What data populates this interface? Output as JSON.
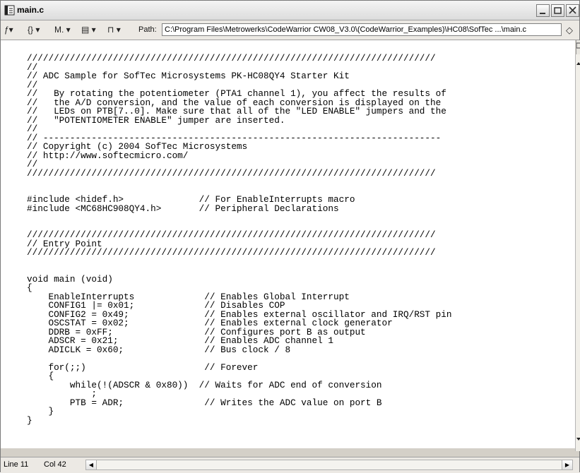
{
  "window": {
    "title": "main.c"
  },
  "toolbar": {
    "items": [
      {
        "icon": "function-icon",
        "label": "ƒ▾"
      },
      {
        "icon": "braces-icon",
        "label": "{} ▾"
      },
      {
        "icon": "marker-icon",
        "label": "M. ▾"
      },
      {
        "icon": "document-icon",
        "label": "▤ ▾"
      },
      {
        "icon": "lock-icon",
        "label": "⊓ ▾"
      }
    ],
    "path_label": "Path:",
    "path_value": "C:\\Program Files\\Metrowerks\\CodeWarrior CW08_V3.0\\(CodeWarrior_Examples)\\HC08\\SofTec ...\\main.c"
  },
  "code_lines": [
    "////////////////////////////////////////////////////////////////////////////",
    "//",
    "// ADC Sample for SofTec Microsystems PK-HC08QY4 Starter Kit",
    "//",
    "//   By rotating the potentiometer (PTA1 channel 1), you affect the results of",
    "//   the A/D conversion, and the value of each conversion is displayed on the",
    "//   LEDs on PTB[7..0]. Make sure that all of the \"LED ENABLE\" jumpers and the",
    "//   \"POTENTIOMETER ENABLE\" jumper are inserted.",
    "//",
    "// --------------------------------------------------------------------------",
    "// Copyright (c) 2004 SofTec Microsystems",
    "// http://www.softecmicro.com/",
    "//",
    "////////////////////////////////////////////////////////////////////////////",
    "",
    "",
    "#include <hidef.h>              // For EnableInterrupts macro",
    "#include <MC68HC908QY4.h>       // Peripheral Declarations",
    "",
    "",
    "////////////////////////////////////////////////////////////////////////////",
    "// Entry Point",
    "////////////////////////////////////////////////////////////////////////////",
    "",
    "",
    "void main (void)",
    "{",
    "    EnableInterrupts             // Enables Global Interrupt",
    "    CONFIG1 |= 0x01;             // Disables COP",
    "    CONFIG2 = 0x49;              // Enables external oscillator and IRQ/RST pin",
    "    OSCSTAT = 0x02;              // Enables external clock generator",
    "    DDRB = 0xFF;                 // Configures port B as output",
    "    ADSCR = 0x21;                // Enables ADC channel 1",
    "    ADICLK = 0x60;               // Bus clock / 8",
    "",
    "    for(;;)                      // Forever",
    "    {",
    "        while(!(ADSCR & 0x80))  // Waits for ADC end of conversion",
    "            ;",
    "        PTB = ADR;               // Writes the ADC value on port B",
    "    }",
    "}"
  ],
  "status": {
    "line": "Line 11",
    "col": "Col 42"
  }
}
